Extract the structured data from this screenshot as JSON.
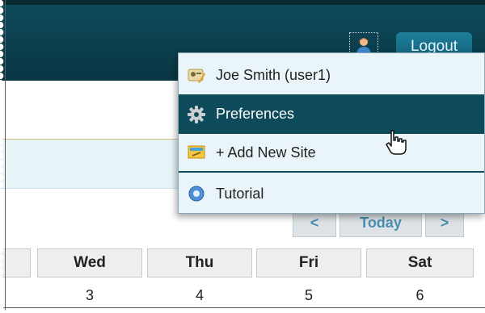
{
  "header": {
    "logout_label": "Logout",
    "user_icon": "user-icon"
  },
  "menu": {
    "items": [
      {
        "label": "Joe Smith (user1)",
        "icon": "profile-card-icon"
      },
      {
        "label": "Preferences",
        "icon": "gear-icon"
      },
      {
        "label": "+ Add New Site",
        "icon": "add-site-icon"
      },
      {
        "label": "Tutorial",
        "icon": "help-icon"
      }
    ]
  },
  "calendar_nav": {
    "prev_label": "<",
    "today_label": "Today",
    "next_label": ">"
  },
  "calendar": {
    "days": [
      {
        "name": "",
        "num": ""
      },
      {
        "name": "Wed",
        "num": "3"
      },
      {
        "name": "Thu",
        "num": "4"
      },
      {
        "name": "Fri",
        "num": "5"
      },
      {
        "name": "Sat",
        "num": "6"
      }
    ]
  },
  "colors": {
    "header_bg": "#0d4a5a",
    "menu_bg": "#eaf5f9",
    "menu_hover": "#0d4a5a",
    "nav_text": "#4a8fb2"
  }
}
